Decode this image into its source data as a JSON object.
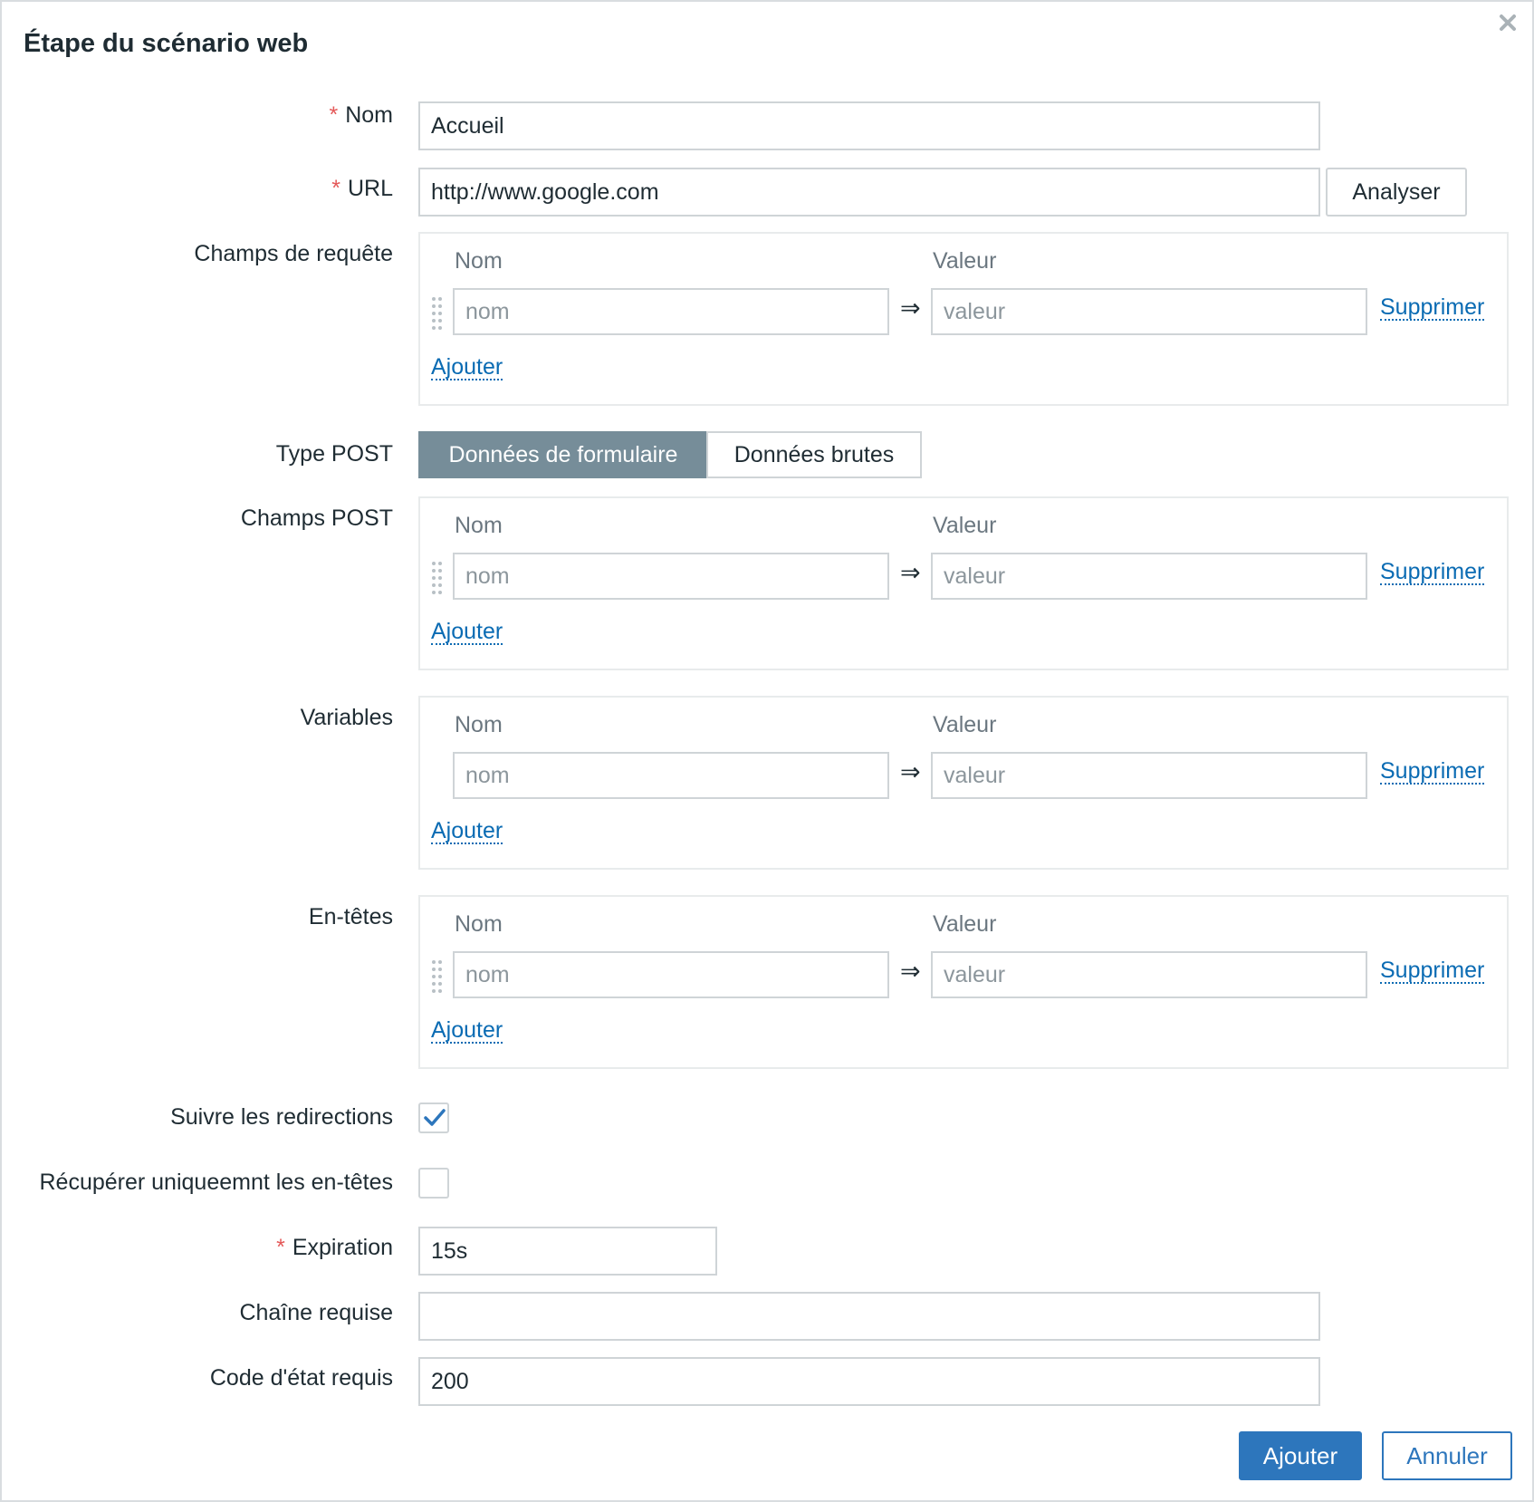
{
  "dialog": {
    "title": "Étape du scénario web",
    "close_icon": "close-icon"
  },
  "fields": {
    "name": {
      "label": "Nom",
      "required_mark": "*",
      "value": "Accueil"
    },
    "url": {
      "label": "URL",
      "required_mark": "*",
      "value": "http://www.google.com",
      "parse_button": "Analyser"
    },
    "query_fields": {
      "label": "Champs de requête",
      "col_name": "Nom",
      "col_value": "Valeur",
      "name_placeholder": "nom",
      "value_placeholder": "valeur",
      "arrow": "⇒",
      "remove": "Supprimer",
      "add": "Ajouter"
    },
    "post_type": {
      "label": "Type POST",
      "options": [
        "Données de formulaire",
        "Données brutes"
      ],
      "selected": "Données de formulaire"
    },
    "post_fields": {
      "label": "Champs POST",
      "col_name": "Nom",
      "col_value": "Valeur",
      "name_placeholder": "nom",
      "value_placeholder": "valeur",
      "arrow": "⇒",
      "remove": "Supprimer",
      "add": "Ajouter"
    },
    "variables": {
      "label": "Variables",
      "col_name": "Nom",
      "col_value": "Valeur",
      "name_placeholder": "nom",
      "value_placeholder": "valeur",
      "arrow": "⇒",
      "remove": "Supprimer",
      "add": "Ajouter"
    },
    "headers": {
      "label": "En-têtes",
      "col_name": "Nom",
      "col_value": "Valeur",
      "name_placeholder": "nom",
      "value_placeholder": "valeur",
      "arrow": "⇒",
      "remove": "Supprimer",
      "add": "Ajouter"
    },
    "follow_redirects": {
      "label": "Suivre les redirections",
      "checked": true
    },
    "retrieve_headers_only": {
      "label": "Récupérer uniqueemnt les en-têtes",
      "checked": false
    },
    "timeout": {
      "label": "Expiration",
      "required_mark": "*",
      "value": "15s"
    },
    "required_string": {
      "label": "Chaîne requise",
      "value": ""
    },
    "status_codes": {
      "label": "Code d'état requis",
      "value": "200"
    }
  },
  "footer": {
    "add_button": "Ajouter",
    "cancel_button": "Annuler"
  },
  "colors": {
    "primary": "#2d76bc",
    "link": "#0a6bb3",
    "segment_active": "#768d99",
    "required": "#e45959"
  }
}
